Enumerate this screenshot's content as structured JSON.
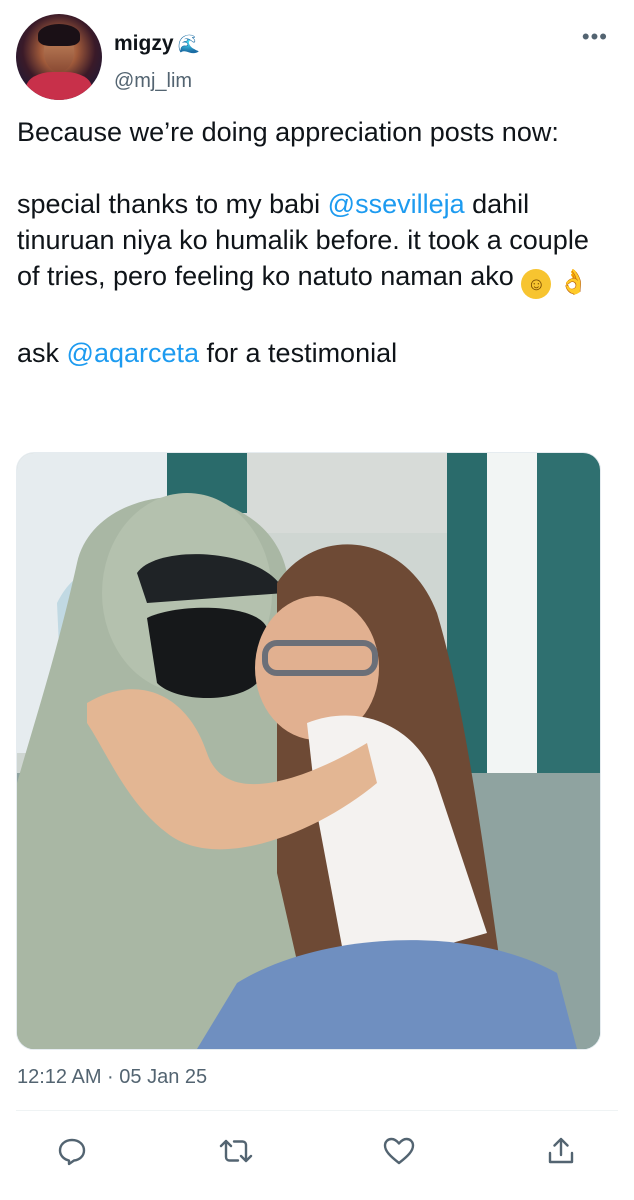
{
  "tweet": {
    "author": {
      "display_name": "migzy",
      "name_emoji": "🌊",
      "handle": "@mj_lim",
      "avatar_icon": "profile-avatar"
    },
    "more_label": "•••",
    "text": {
      "line1": "Because we’re doing appreciation posts now:",
      "p2_before": "special thanks to my babi ",
      "p2_mention": "@ssevilleja",
      "p2_after": " dahil tinuruan niya ko humalik before. it took a couple of tries, pero feeling ko natuto naman ako ",
      "p2_emoji1": "😊",
      "p2_emoji2": "👌",
      "p3_before": "ask ",
      "p3_mention": "@aqarceta",
      "p3_after": " for a testimonial"
    },
    "media": {
      "description": "photo"
    },
    "timestamp": "12:12 AM · 05 Jan 25",
    "actions": {
      "reply_icon": "reply-icon",
      "retweet_icon": "retweet-icon",
      "like_icon": "heart-icon",
      "share_icon": "share-icon"
    }
  },
  "colors": {
    "text": "#0f1419",
    "secondary": "#536471",
    "link": "#1d9bf0",
    "divider": "#eff3f4"
  }
}
